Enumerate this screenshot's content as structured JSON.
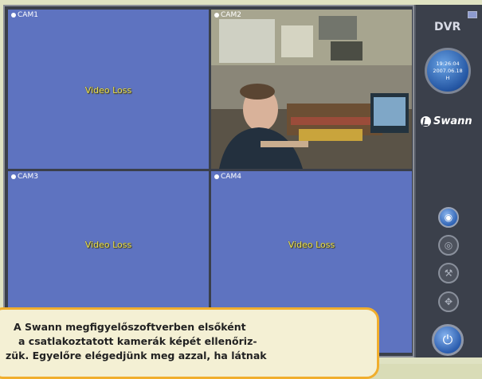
{
  "panel": {
    "logo_text": "DVR",
    "clock_time": "19:26:04",
    "clock_date": "2007.06.18",
    "clock_mode": "H",
    "brand": "Swann"
  },
  "cameras": [
    {
      "label": "CAM1",
      "status": "Video Loss"
    },
    {
      "label": "CAM2",
      "status": ""
    },
    {
      "label": "CAM3",
      "status": "Video Loss"
    },
    {
      "label": "CAM4",
      "status": "Video Loss"
    }
  ],
  "controls": [
    {
      "icon": "mouse-icon",
      "glyph": "◉"
    },
    {
      "icon": "camera-icon",
      "glyph": "◎"
    },
    {
      "icon": "wrench-icon",
      "glyph": "⚒"
    },
    {
      "icon": "ptz-icon",
      "glyph": "✥"
    }
  ],
  "power_glyph": "⏻",
  "caption": {
    "line1": "A Swann megfigyelőszoftverben elsőként",
    "line2": "a csatlakoztatott kamerák képét ellenőriz-",
    "line3": "zük. Egyelőre elégedjünk meg azzal, ha látnak"
  },
  "colors": {
    "tile": "#5e73c0",
    "accent": "#f0ae2d",
    "video_loss": "#e9e25b"
  }
}
